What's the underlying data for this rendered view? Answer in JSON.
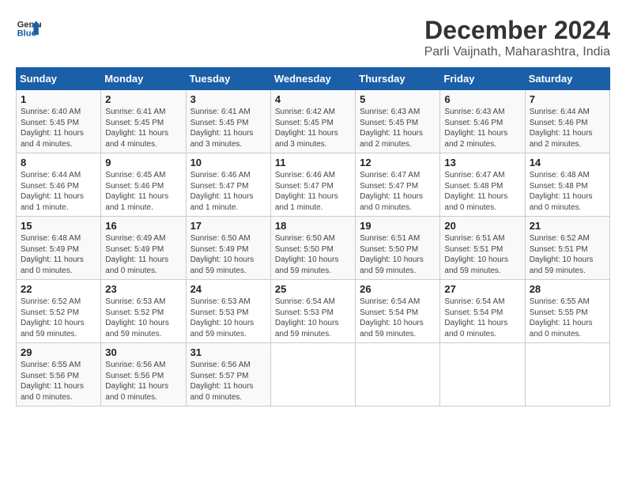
{
  "logo": {
    "line1": "General",
    "line2": "Blue"
  },
  "title": "December 2024",
  "subtitle": "Parli Vaijnath, Maharashtra, India",
  "days_header": [
    "Sunday",
    "Monday",
    "Tuesday",
    "Wednesday",
    "Thursday",
    "Friday",
    "Saturday"
  ],
  "weeks": [
    [
      {
        "day": "1",
        "info": "Sunrise: 6:40 AM\nSunset: 5:45 PM\nDaylight: 11 hours and 4 minutes."
      },
      {
        "day": "2",
        "info": "Sunrise: 6:41 AM\nSunset: 5:45 PM\nDaylight: 11 hours and 4 minutes."
      },
      {
        "day": "3",
        "info": "Sunrise: 6:41 AM\nSunset: 5:45 PM\nDaylight: 11 hours and 3 minutes."
      },
      {
        "day": "4",
        "info": "Sunrise: 6:42 AM\nSunset: 5:45 PM\nDaylight: 11 hours and 3 minutes."
      },
      {
        "day": "5",
        "info": "Sunrise: 6:43 AM\nSunset: 5:45 PM\nDaylight: 11 hours and 2 minutes."
      },
      {
        "day": "6",
        "info": "Sunrise: 6:43 AM\nSunset: 5:46 PM\nDaylight: 11 hours and 2 minutes."
      },
      {
        "day": "7",
        "info": "Sunrise: 6:44 AM\nSunset: 5:46 PM\nDaylight: 11 hours and 2 minutes."
      }
    ],
    [
      {
        "day": "8",
        "info": "Sunrise: 6:44 AM\nSunset: 5:46 PM\nDaylight: 11 hours and 1 minute."
      },
      {
        "day": "9",
        "info": "Sunrise: 6:45 AM\nSunset: 5:46 PM\nDaylight: 11 hours and 1 minute."
      },
      {
        "day": "10",
        "info": "Sunrise: 6:46 AM\nSunset: 5:47 PM\nDaylight: 11 hours and 1 minute."
      },
      {
        "day": "11",
        "info": "Sunrise: 6:46 AM\nSunset: 5:47 PM\nDaylight: 11 hours and 1 minute."
      },
      {
        "day": "12",
        "info": "Sunrise: 6:47 AM\nSunset: 5:47 PM\nDaylight: 11 hours and 0 minutes."
      },
      {
        "day": "13",
        "info": "Sunrise: 6:47 AM\nSunset: 5:48 PM\nDaylight: 11 hours and 0 minutes."
      },
      {
        "day": "14",
        "info": "Sunrise: 6:48 AM\nSunset: 5:48 PM\nDaylight: 11 hours and 0 minutes."
      }
    ],
    [
      {
        "day": "15",
        "info": "Sunrise: 6:48 AM\nSunset: 5:49 PM\nDaylight: 11 hours and 0 minutes."
      },
      {
        "day": "16",
        "info": "Sunrise: 6:49 AM\nSunset: 5:49 PM\nDaylight: 11 hours and 0 minutes."
      },
      {
        "day": "17",
        "info": "Sunrise: 6:50 AM\nSunset: 5:49 PM\nDaylight: 10 hours and 59 minutes."
      },
      {
        "day": "18",
        "info": "Sunrise: 6:50 AM\nSunset: 5:50 PM\nDaylight: 10 hours and 59 minutes."
      },
      {
        "day": "19",
        "info": "Sunrise: 6:51 AM\nSunset: 5:50 PM\nDaylight: 10 hours and 59 minutes."
      },
      {
        "day": "20",
        "info": "Sunrise: 6:51 AM\nSunset: 5:51 PM\nDaylight: 10 hours and 59 minutes."
      },
      {
        "day": "21",
        "info": "Sunrise: 6:52 AM\nSunset: 5:51 PM\nDaylight: 10 hours and 59 minutes."
      }
    ],
    [
      {
        "day": "22",
        "info": "Sunrise: 6:52 AM\nSunset: 5:52 PM\nDaylight: 10 hours and 59 minutes."
      },
      {
        "day": "23",
        "info": "Sunrise: 6:53 AM\nSunset: 5:52 PM\nDaylight: 10 hours and 59 minutes."
      },
      {
        "day": "24",
        "info": "Sunrise: 6:53 AM\nSunset: 5:53 PM\nDaylight: 10 hours and 59 minutes."
      },
      {
        "day": "25",
        "info": "Sunrise: 6:54 AM\nSunset: 5:53 PM\nDaylight: 10 hours and 59 minutes."
      },
      {
        "day": "26",
        "info": "Sunrise: 6:54 AM\nSunset: 5:54 PM\nDaylight: 10 hours and 59 minutes."
      },
      {
        "day": "27",
        "info": "Sunrise: 6:54 AM\nSunset: 5:54 PM\nDaylight: 11 hours and 0 minutes."
      },
      {
        "day": "28",
        "info": "Sunrise: 6:55 AM\nSunset: 5:55 PM\nDaylight: 11 hours and 0 minutes."
      }
    ],
    [
      {
        "day": "29",
        "info": "Sunrise: 6:55 AM\nSunset: 5:56 PM\nDaylight: 11 hours and 0 minutes."
      },
      {
        "day": "30",
        "info": "Sunrise: 6:56 AM\nSunset: 5:56 PM\nDaylight: 11 hours and 0 minutes."
      },
      {
        "day": "31",
        "info": "Sunrise: 6:56 AM\nSunset: 5:57 PM\nDaylight: 11 hours and 0 minutes."
      },
      null,
      null,
      null,
      null
    ]
  ]
}
